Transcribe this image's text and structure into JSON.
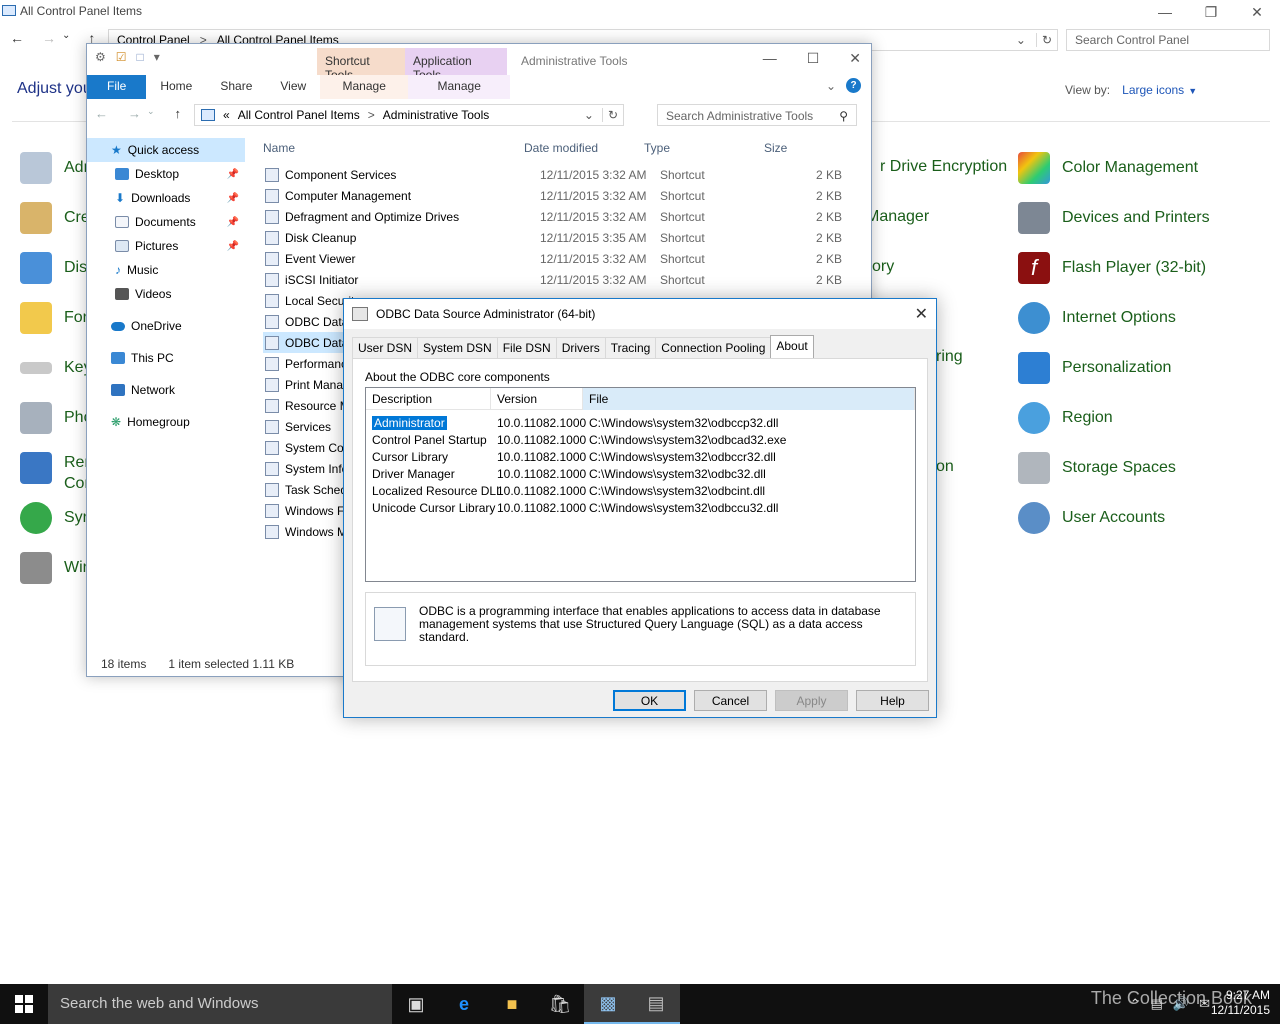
{
  "cp": {
    "title": "All Control Panel Items",
    "crumbs": [
      "Control Panel",
      "All Control Panel Items"
    ],
    "search_placeholder": "Search Control Panel",
    "heading": "Adjust you",
    "view_by_label": "View by:",
    "view_by_value": "Large icons",
    "left_items": [
      "Adm",
      "Cre",
      "Disp",
      "Fon",
      "Key",
      "Pho",
      "Ren",
      "Con",
      "Syn",
      "Win"
    ],
    "middle_items": [
      "r Drive Encryption",
      "Manager",
      "ory",
      "ring",
      "on"
    ],
    "right_items": [
      "Color Management",
      "Devices and Printers",
      "Flash Player (32-bit)",
      "Internet Options",
      "Personalization",
      "Region",
      "Storage Spaces",
      "User Accounts"
    ]
  },
  "explorer": {
    "ctx1": "Shortcut Tools",
    "ctx2": "Application Tools",
    "title": "Administrative Tools",
    "tabs": [
      "File",
      "Home",
      "Share",
      "View",
      "Manage",
      "Manage"
    ],
    "address_prefix": "«",
    "address": [
      "All Control Panel Items",
      "Administrative Tools"
    ],
    "search_placeholder": "Search Administrative Tools",
    "sidebar": [
      "Quick access",
      "Desktop",
      "Downloads",
      "Documents",
      "Pictures",
      "Music",
      "Videos",
      "OneDrive",
      "This PC",
      "Network",
      "Homegroup"
    ],
    "columns": [
      "Name",
      "Date modified",
      "Type",
      "Size"
    ],
    "files": [
      {
        "name": "Component Services",
        "date": "12/11/2015 3:32 AM",
        "type": "Shortcut",
        "size": "2 KB"
      },
      {
        "name": "Computer Management",
        "date": "12/11/2015 3:32 AM",
        "type": "Shortcut",
        "size": "2 KB"
      },
      {
        "name": "Defragment and Optimize Drives",
        "date": "12/11/2015 3:32 AM",
        "type": "Shortcut",
        "size": "2 KB"
      },
      {
        "name": "Disk Cleanup",
        "date": "12/11/2015 3:35 AM",
        "type": "Shortcut",
        "size": "2 KB"
      },
      {
        "name": "Event Viewer",
        "date": "12/11/2015 3:32 AM",
        "type": "Shortcut",
        "size": "2 KB"
      },
      {
        "name": "iSCSI Initiator",
        "date": "12/11/2015 3:32 AM",
        "type": "Shortcut",
        "size": "2 KB"
      },
      {
        "name": "Local Securit",
        "date": "",
        "type": "",
        "size": ""
      },
      {
        "name": "ODBC Data",
        "date": "",
        "type": "",
        "size": ""
      },
      {
        "name": "ODBC Data",
        "date": "",
        "type": "",
        "size": ""
      },
      {
        "name": "Performanc",
        "date": "",
        "type": "",
        "size": ""
      },
      {
        "name": "Print Manag",
        "date": "",
        "type": "",
        "size": ""
      },
      {
        "name": "Resource M",
        "date": "",
        "type": "",
        "size": ""
      },
      {
        "name": "Services",
        "date": "",
        "type": "",
        "size": ""
      },
      {
        "name": "System Con",
        "date": "",
        "type": "",
        "size": ""
      },
      {
        "name": "System Info",
        "date": "",
        "type": "",
        "size": ""
      },
      {
        "name": "Task Sched",
        "date": "",
        "type": "",
        "size": ""
      },
      {
        "name": "Windows F",
        "date": "",
        "type": "",
        "size": ""
      },
      {
        "name": "Windows M",
        "date": "",
        "type": "",
        "size": ""
      }
    ],
    "status_count": "18 items",
    "status_selected": "1 item selected  1.11 KB"
  },
  "dialog": {
    "title": "ODBC Data Source Administrator (64-bit)",
    "tabs": [
      "User DSN",
      "System DSN",
      "File DSN",
      "Drivers",
      "Tracing",
      "Connection Pooling",
      "About"
    ],
    "group_label": "About the ODBC core components",
    "columns": [
      "Description",
      "Version",
      "File"
    ],
    "rows": [
      {
        "desc": "Administrator",
        "ver": "10.0.11082.1000",
        "file": "C:\\Windows\\system32\\odbccp32.dll"
      },
      {
        "desc": "Control Panel Startup",
        "ver": "10.0.11082.1000",
        "file": "C:\\Windows\\system32\\odbcad32.exe"
      },
      {
        "desc": "Cursor Library",
        "ver": "10.0.11082.1000",
        "file": "C:\\Windows\\system32\\odbccr32.dll"
      },
      {
        "desc": "Driver Manager",
        "ver": "10.0.11082.1000",
        "file": "C:\\Windows\\system32\\odbc32.dll"
      },
      {
        "desc": "Localized Resource DLL",
        "ver": "10.0.11082.1000",
        "file": "C:\\Windows\\system32\\odbcint.dll"
      },
      {
        "desc": "Unicode Cursor Library",
        "ver": "10.0.11082.1000",
        "file": "C:\\Windows\\system32\\odbccu32.dll"
      }
    ],
    "info_text": "ODBC is a programming interface that enables applications to access data in database management systems that use Structured Query Language (SQL) as a data access standard.",
    "buttons": {
      "ok": "OK",
      "cancel": "Cancel",
      "apply": "Apply",
      "help": "Help"
    }
  },
  "taskbar": {
    "search_placeholder": "Search the web and Windows",
    "watermark": "The Collection Book",
    "time": "9:27 AM",
    "date": "12/11/2015"
  }
}
